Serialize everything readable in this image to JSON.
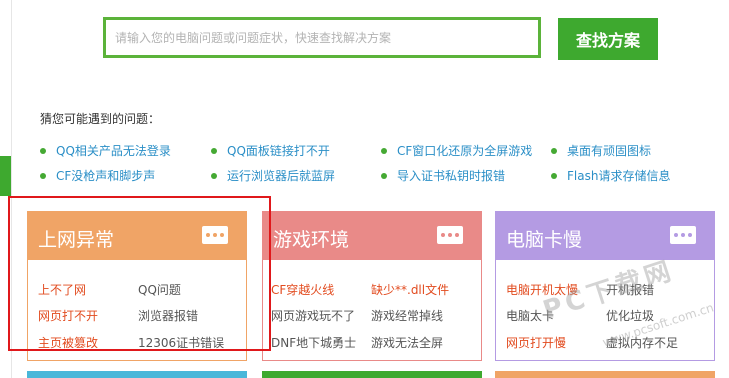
{
  "search": {
    "placeholder": "请输入您的电脑问题或问题症状，快速查找解决方案",
    "button_label": "查找方案"
  },
  "guess": {
    "title": "猜您可能遇到的问题：",
    "links": [
      "QQ相关产品无法登录",
      "QQ面板链接打不开",
      "CF窗口化还原为全屏游戏",
      "桌面有顽固图标",
      "CF没枪声和脚步声",
      "运行浏览器后就蓝屏",
      "导入证书私钥时报错",
      "Flash请求存储信息"
    ]
  },
  "cards": [
    {
      "title": "上网异常",
      "color": "#f0a466",
      "links": [
        "上不了网",
        "QQ问题",
        "网页打不开",
        "浏览器报错",
        "主页被篡改",
        "12306证书错误"
      ]
    },
    {
      "title": "游戏环境",
      "color": "#e98a88",
      "links": [
        "CF穿越火线",
        "缺少**.dll文件",
        "网页游戏玩不了",
        "游戏经常掉线",
        "DNF地下城勇士",
        "游戏无法全屏"
      ]
    },
    {
      "title": "电脑卡慢",
      "color": "#b49be3",
      "links": [
        "电脑开机太慢",
        "开机报错",
        "电脑太卡",
        "优化垃圾",
        "网页打开慢",
        "虚拟内存不足"
      ]
    }
  ],
  "colors": {
    "accent_green": "#3ea92f",
    "link_blue": "#2b8fc7",
    "hot_red": "#e24b1f",
    "highlight_red": "#e0181b"
  },
  "watermark": {
    "text": "PC下载网",
    "url": "www.pcsoft.com.cn"
  },
  "bottom_strip_colors": [
    "#49b7d9",
    "#3ea92f",
    "#f0a466"
  ]
}
